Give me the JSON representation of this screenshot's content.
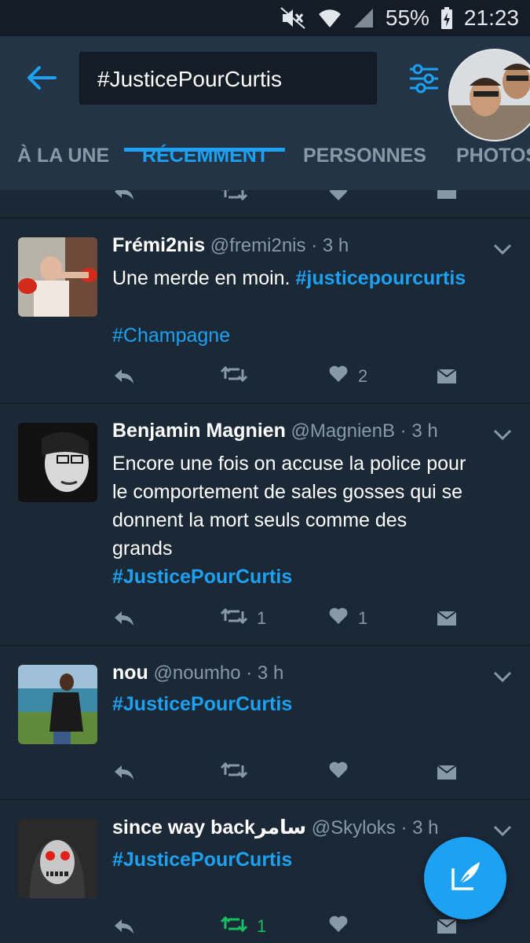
{
  "status_bar": {
    "battery": "55%",
    "time": "21:23"
  },
  "search": {
    "query": "#JusticePourCurtis"
  },
  "tabs": [
    {
      "label": "À LA UNE"
    },
    {
      "label": "RÉCEMMENT"
    },
    {
      "label": "PERSONNES"
    },
    {
      "label": "PHOTOS"
    }
  ],
  "tweets": [
    {
      "name": "Frémi2nis",
      "handle": "@fremi2nis",
      "time": "· 3 h",
      "text": "Une merde en moin.",
      "hashtag1": "#justicepourcurtis",
      "hashtag2": "#Champagne",
      "retweets": "",
      "likes": "2"
    },
    {
      "name": "Benjamin Magnien",
      "handle": "@MagnienB",
      "time": "· 3 h",
      "line1": "Encore une fois on accuse la police pour",
      "line2": "le comportement de sales gosses qui se",
      "line3": "donnent la mort seuls comme des",
      "line4": "grands",
      "hashtag1": "#JusticePourCurtis",
      "retweets": "1",
      "likes": "1"
    },
    {
      "name": "nou",
      "handle": "@noumho",
      "time": "· 3 h",
      "hashtag1": "#JusticePourCurtis",
      "retweets": "",
      "likes": ""
    },
    {
      "name": "since way backسامر",
      "handle": "@Skyloks",
      "time": "· 3 h",
      "hashtag1": "#JusticePourCurtis",
      "retweets": "1",
      "likes": ""
    }
  ],
  "colors": {
    "accent": "#1da1f2",
    "retweet_green": "#17bf63",
    "background": "#1b2836",
    "header": "#243447"
  }
}
